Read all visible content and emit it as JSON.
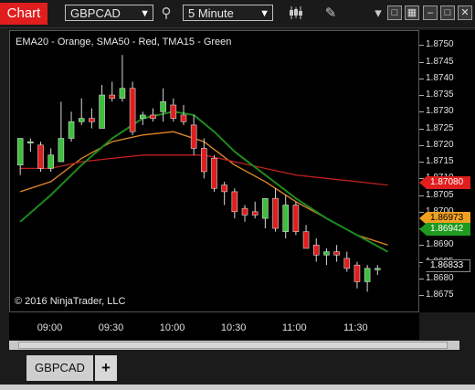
{
  "toolbar": {
    "title": "Chart",
    "instrument": "GBPCAD",
    "interval": "5 Minute"
  },
  "chart": {
    "indicator_label": "EMA20 - Orange, SMA50 - Red, TMA15 - Green",
    "copyright": "© 2016 NinjaTrader, LLC",
    "price_badges": [
      {
        "label": "1.87080",
        "color": "#e01e1e",
        "text_color": "#ffffff"
      },
      {
        "label": "1.86973",
        "color": "#f0a020",
        "text_color": "#000000"
      },
      {
        "label": "1.86942",
        "color": "#1e9a1e",
        "text_color": "#ffffff"
      },
      {
        "label": "1.86833",
        "color": "#000000",
        "text_color": "#ffffff"
      }
    ]
  },
  "tabs": {
    "active": "GBPCAD",
    "add": "+"
  },
  "chart_data": {
    "type": "candlestick",
    "title": "",
    "x_ticks": [
      "09:00",
      "09:30",
      "10:00",
      "10:30",
      "11:00",
      "11:30"
    ],
    "y_ticks": [
      "1.8750",
      "1.8745",
      "1.8740",
      "1.8735",
      "1.8730",
      "1.8725",
      "1.8720",
      "1.8715",
      "1.8710",
      "1.8705",
      "1.8700",
      "1.8695",
      "1.8690",
      "1.8685",
      "1.8680",
      "1.8675"
    ],
    "ylim": [
      1.8672,
      1.8752
    ],
    "xlim": [
      "08:40",
      "12:00"
    ],
    "candles": [
      {
        "t": "08:45",
        "o": 1.8714,
        "h": 1.8722,
        "l": 1.8711,
        "c": 1.8722
      },
      {
        "t": "08:50",
        "o": 1.8721,
        "h": 1.8722,
        "l": 1.8718,
        "c": 1.8721
      },
      {
        "t": "08:55",
        "o": 1.872,
        "h": 1.8721,
        "l": 1.8712,
        "c": 1.8713
      },
      {
        "t": "09:00",
        "o": 1.8713,
        "h": 1.8719,
        "l": 1.8712,
        "c": 1.8717
      },
      {
        "t": "09:05",
        "o": 1.8715,
        "h": 1.8733,
        "l": 1.8715,
        "c": 1.8722
      },
      {
        "t": "09:10",
        "o": 1.8722,
        "h": 1.873,
        "l": 1.8721,
        "c": 1.8727
      },
      {
        "t": "09:15",
        "o": 1.8727,
        "h": 1.8734,
        "l": 1.8726,
        "c": 1.8728
      },
      {
        "t": "09:20",
        "o": 1.8728,
        "h": 1.8731,
        "l": 1.8725,
        "c": 1.8727
      },
      {
        "t": "09:25",
        "o": 1.8725,
        "h": 1.8738,
        "l": 1.8725,
        "c": 1.8735
      },
      {
        "t": "09:30",
        "o": 1.8735,
        "h": 1.8739,
        "l": 1.8733,
        "c": 1.8734
      },
      {
        "t": "09:35",
        "o": 1.8734,
        "h": 1.8747,
        "l": 1.8733,
        "c": 1.8737
      },
      {
        "t": "09:40",
        "o": 1.8737,
        "h": 1.8739,
        "l": 1.8723,
        "c": 1.8724
      },
      {
        "t": "09:45",
        "o": 1.8728,
        "h": 1.873,
        "l": 1.8726,
        "c": 1.8729
      },
      {
        "t": "09:50",
        "o": 1.8729,
        "h": 1.8731,
        "l": 1.8727,
        "c": 1.8728
      },
      {
        "t": "09:55",
        "o": 1.873,
        "h": 1.8737,
        "l": 1.8727,
        "c": 1.8733
      },
      {
        "t": "10:00",
        "o": 1.8732,
        "h": 1.8734,
        "l": 1.8727,
        "c": 1.8728
      },
      {
        "t": "10:05",
        "o": 1.8729,
        "h": 1.8732,
        "l": 1.8726,
        "c": 1.8727
      },
      {
        "t": "10:10",
        "o": 1.8726,
        "h": 1.8729,
        "l": 1.8717,
        "c": 1.8719
      },
      {
        "t": "10:15",
        "o": 1.8719,
        "h": 1.8722,
        "l": 1.871,
        "c": 1.8712
      },
      {
        "t": "10:20",
        "o": 1.8716,
        "h": 1.8717,
        "l": 1.8706,
        "c": 1.8707
      },
      {
        "t": "10:25",
        "o": 1.8708,
        "h": 1.8709,
        "l": 1.8702,
        "c": 1.8706
      },
      {
        "t": "10:30",
        "o": 1.8706,
        "h": 1.8707,
        "l": 1.8698,
        "c": 1.87
      },
      {
        "t": "10:35",
        "o": 1.8701,
        "h": 1.8702,
        "l": 1.8697,
        "c": 1.8699
      },
      {
        "t": "10:40",
        "o": 1.87,
        "h": 1.8703,
        "l": 1.8698,
        "c": 1.8699
      },
      {
        "t": "10:45",
        "o": 1.8698,
        "h": 1.8704,
        "l": 1.8695,
        "c": 1.8704
      },
      {
        "t": "10:50",
        "o": 1.8704,
        "h": 1.8707,
        "l": 1.8694,
        "c": 1.8695
      },
      {
        "t": "10:55",
        "o": 1.8694,
        "h": 1.8705,
        "l": 1.8692,
        "c": 1.8702
      },
      {
        "t": "11:00",
        "o": 1.8702,
        "h": 1.8703,
        "l": 1.8693,
        "c": 1.8694
      },
      {
        "t": "11:05",
        "o": 1.8694,
        "h": 1.8696,
        "l": 1.8689,
        "c": 1.8689
      },
      {
        "t": "11:10",
        "o": 1.869,
        "h": 1.8692,
        "l": 1.8685,
        "c": 1.8687
      },
      {
        "t": "11:15",
        "o": 1.8687,
        "h": 1.8689,
        "l": 1.8684,
        "c": 1.8688
      },
      {
        "t": "11:20",
        "o": 1.8688,
        "h": 1.869,
        "l": 1.8685,
        "c": 1.8687
      },
      {
        "t": "11:25",
        "o": 1.8686,
        "h": 1.8688,
        "l": 1.8682,
        "c": 1.8683
      },
      {
        "t": "11:30",
        "o": 1.8684,
        "h": 1.8685,
        "l": 1.8677,
        "c": 1.8679
      },
      {
        "t": "11:35",
        "o": 1.8679,
        "h": 1.8684,
        "l": 1.8676,
        "c": 1.8683
      },
      {
        "t": "11:40",
        "o": 1.8683,
        "h": 1.8684,
        "l": 1.8681,
        "c": 1.8683
      }
    ],
    "series": [
      {
        "name": "EMA20",
        "color": "#e08a2a",
        "points": [
          [
            "08:45",
            1.8706
          ],
          [
            "09:00",
            1.8709
          ],
          [
            "09:15",
            1.8716
          ],
          [
            "09:30",
            1.8721
          ],
          [
            "09:45",
            1.8723
          ],
          [
            "10:00",
            1.8724
          ],
          [
            "10:15",
            1.8721
          ],
          [
            "10:30",
            1.8714
          ],
          [
            "10:45",
            1.8709
          ],
          [
            "11:00",
            1.8703
          ],
          [
            "11:15",
            1.8698
          ],
          [
            "11:30",
            1.8693
          ],
          [
            "11:45",
            1.869
          ]
        ]
      },
      {
        "name": "SMA50",
        "color": "#c0201e",
        "points": [
          [
            "08:45",
            1.8713
          ],
          [
            "09:00",
            1.8713
          ],
          [
            "09:15",
            1.8715
          ],
          [
            "09:30",
            1.8716
          ],
          [
            "09:45",
            1.8717
          ],
          [
            "10:00",
            1.8717
          ],
          [
            "10:15",
            1.8717
          ],
          [
            "10:30",
            1.8715
          ],
          [
            "10:45",
            1.8713
          ],
          [
            "11:00",
            1.8711
          ],
          [
            "11:15",
            1.871
          ],
          [
            "11:30",
            1.8709
          ],
          [
            "11:45",
            1.8708
          ]
        ]
      },
      {
        "name": "TMA15",
        "color": "#1e8a1e",
        "points": [
          [
            "08:45",
            1.8697
          ],
          [
            "09:00",
            1.8705
          ],
          [
            "09:15",
            1.8714
          ],
          [
            "09:30",
            1.8722
          ],
          [
            "09:45",
            1.8728
          ],
          [
            "10:00",
            1.873
          ],
          [
            "10:10",
            1.8729
          ],
          [
            "10:20",
            1.8724
          ],
          [
            "10:30",
            1.8718
          ],
          [
            "10:45",
            1.8711
          ],
          [
            "11:00",
            1.8704
          ],
          [
            "11:15",
            1.8698
          ],
          [
            "11:30",
            1.8693
          ],
          [
            "11:45",
            1.8688
          ]
        ]
      }
    ]
  }
}
